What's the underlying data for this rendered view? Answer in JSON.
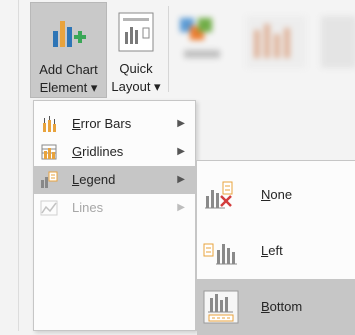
{
  "ribbon": {
    "add_chart_element": {
      "line1": "Add Chart",
      "line2": "Element ▾"
    },
    "quick_layout": {
      "line1": "Quick",
      "line2": "Layout ▾"
    }
  },
  "menu": {
    "items": [
      {
        "accel": "E",
        "rest": "rror Bars",
        "icon": "error-bars-icon",
        "enabled": true,
        "selected": false
      },
      {
        "accel": "G",
        "rest": "ridlines",
        "icon": "gridlines-icon",
        "enabled": true,
        "selected": false
      },
      {
        "accel": "L",
        "rest": "egend",
        "icon": "legend-icon",
        "enabled": true,
        "selected": true
      },
      {
        "accel": "",
        "rest": "Lines",
        "icon": "lines-icon",
        "enabled": false,
        "selected": false
      }
    ],
    "arrow": "▶"
  },
  "submenu": {
    "items": [
      {
        "accel": "N",
        "rest": "one",
        "icon": "legend-none-icon",
        "selected": false
      },
      {
        "accel": "L",
        "rest": "eft",
        "icon": "legend-left-icon",
        "selected": false
      },
      {
        "accel": "B",
        "rest": "ottom",
        "icon": "legend-bottom-icon",
        "selected": true
      }
    ]
  },
  "colors": {
    "accent_blue": "#2e75b6",
    "accent_green": "#3aa757",
    "accent_orange": "#e8a33d",
    "delete_red": "#d23c3c",
    "selected_bg": "#c6c6c6"
  }
}
